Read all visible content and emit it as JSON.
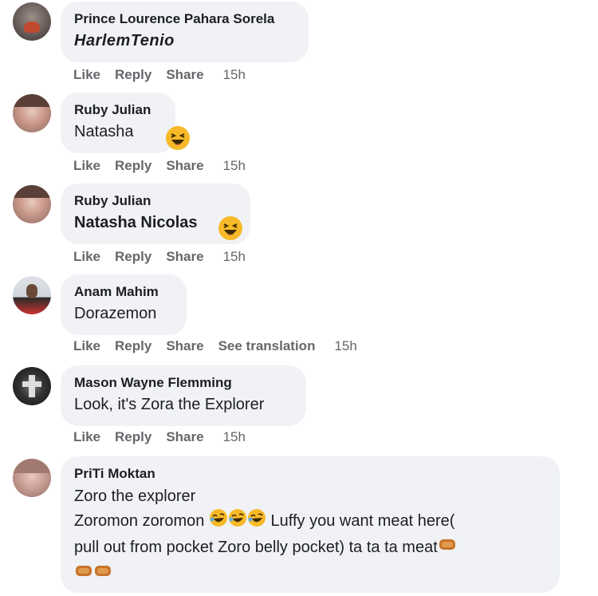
{
  "comments": [
    {
      "author": "Prince Lourence Pahara Sorela",
      "lines": [
        "HarlemTenio"
      ],
      "actions": {
        "like": "Like",
        "reply": "Reply",
        "share": "Share",
        "time": "15h"
      }
    },
    {
      "author": "Ruby Julian",
      "lines": [
        "Natasha"
      ],
      "emoji": "laughing-face-icon",
      "actions": {
        "like": "Like",
        "reply": "Reply",
        "share": "Share",
        "time": "15h"
      }
    },
    {
      "author": "Ruby Julian",
      "lines": [
        "Natasha Nicolas"
      ],
      "emoji": "laughing-face-icon",
      "actions": {
        "like": "Like",
        "reply": "Reply",
        "share": "Share",
        "time": "15h"
      }
    },
    {
      "author": "Anam Mahim",
      "lines": [
        "Dorazemon"
      ],
      "actions": {
        "like": "Like",
        "reply": "Reply",
        "share": "Share",
        "translate": "See translation",
        "time": "15h"
      }
    },
    {
      "author": "Mason Wayne Flemming",
      "lines": [
        "Look, it's Zora the Explorer"
      ],
      "actions": {
        "like": "Like",
        "reply": "Reply",
        "share": "Share",
        "time": "15h"
      }
    },
    {
      "author": "PriTi Moktan",
      "lines": [
        "Zoro the explorer",
        "Zoromon zoromon",
        "Luffy you want meat here(",
        "pull out from pocket Zoro belly pocket) ta ta ta meat"
      ],
      "emojis": [
        "rolling-laughing-face-icon",
        "meat-icon"
      ]
    }
  ],
  "colors": {
    "bubble": "#f0f2f5",
    "text": "#1c1e21",
    "meta": "#65676b",
    "emoji_face": "#f7b928"
  }
}
